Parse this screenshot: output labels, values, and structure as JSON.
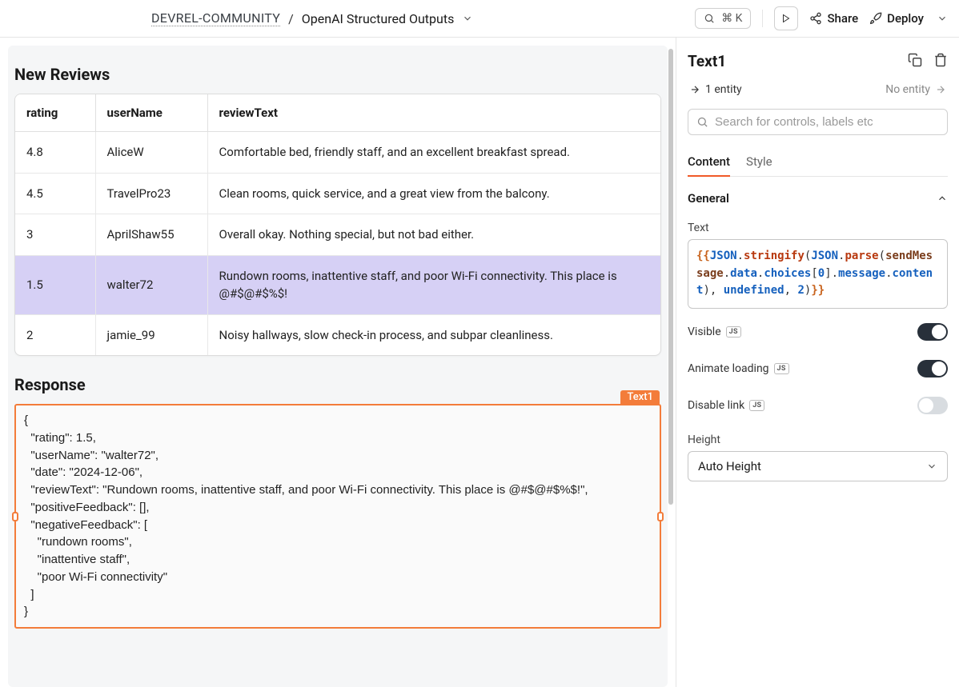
{
  "topbar": {
    "workspace": "DEVREL-COMMUNITY",
    "separator": "/",
    "appName": "OpenAI Structured Outputs",
    "searchShortcut": "⌘ K",
    "share": "Share",
    "deploy": "Deploy"
  },
  "canvas": {
    "reviewsTitle": "New Reviews",
    "table": {
      "headers": [
        "rating",
        "userName",
        "reviewText"
      ],
      "rows": [
        {
          "rating": "4.8",
          "userName": "AliceW",
          "reviewText": "Comfortable bed, friendly staff, and an excellent breakfast spread.",
          "selected": false
        },
        {
          "rating": "4.5",
          "userName": "TravelPro23",
          "reviewText": "Clean rooms, quick service, and a great view from the balcony.",
          "selected": false
        },
        {
          "rating": "3",
          "userName": "AprilShaw55",
          "reviewText": "Overall okay. Nothing special, but not bad either.",
          "selected": false
        },
        {
          "rating": "1.5",
          "userName": "walter72",
          "reviewText": "Rundown rooms, inattentive staff, and poor Wi-Fi connectivity. This place is @#$@#$%$!",
          "selected": true
        },
        {
          "rating": "2",
          "userName": "jamie_99",
          "reviewText": "Noisy hallways, slow check-in process, and subpar cleanliness.",
          "selected": false
        }
      ]
    },
    "responseTitle": "Response",
    "responseBadge": "Text1",
    "responseBody": "{\n  \"rating\": 1.5,\n  \"userName\": \"walter72\",\n  \"date\": \"2024-12-06\",\n  \"reviewText\": \"Rundown rooms, inattentive staff, and poor Wi-Fi connectivity. This place is @#$@#$%$!\",\n  \"positiveFeedback\": [],\n  \"negativeFeedback\": [\n    \"rundown rooms\",\n    \"inattentive staff\",\n    \"poor Wi-Fi connectivity\"\n  ]\n}"
  },
  "panel": {
    "title": "Text1",
    "entityLeft": "1 entity",
    "entityRight": "No entity",
    "searchPlaceholder": "Search for controls, labels etc",
    "tabs": {
      "content": "Content",
      "style": "Style"
    },
    "generalLabel": "General",
    "textLabel": "Text",
    "code": {
      "t1": "{{",
      "t2": "JSON",
      "t3": ".",
      "t4": "stringify",
      "t5": "(",
      "t6": "JSON",
      "t7": ".",
      "t8": "parse",
      "t9": "(",
      "t10": "sendMessage",
      "t11": ".",
      "t12": "data",
      "t13": ".",
      "t14": "choices",
      "t15": "[",
      "t16": "0",
      "t17": "]",
      "t18": ".",
      "t19": "message",
      "t20": ".",
      "t21": "content",
      "t22": ")",
      "t23": ", ",
      "t24": "undefined",
      "t25": ", ",
      "t26": "2",
      "t27": ")",
      "t28": "}}"
    },
    "visibleLabel": "Visible",
    "animateLabel": "Animate loading",
    "disableLinkLabel": "Disable link",
    "jsBadge": "JS",
    "heightLabel": "Height",
    "heightValue": "Auto Height"
  }
}
